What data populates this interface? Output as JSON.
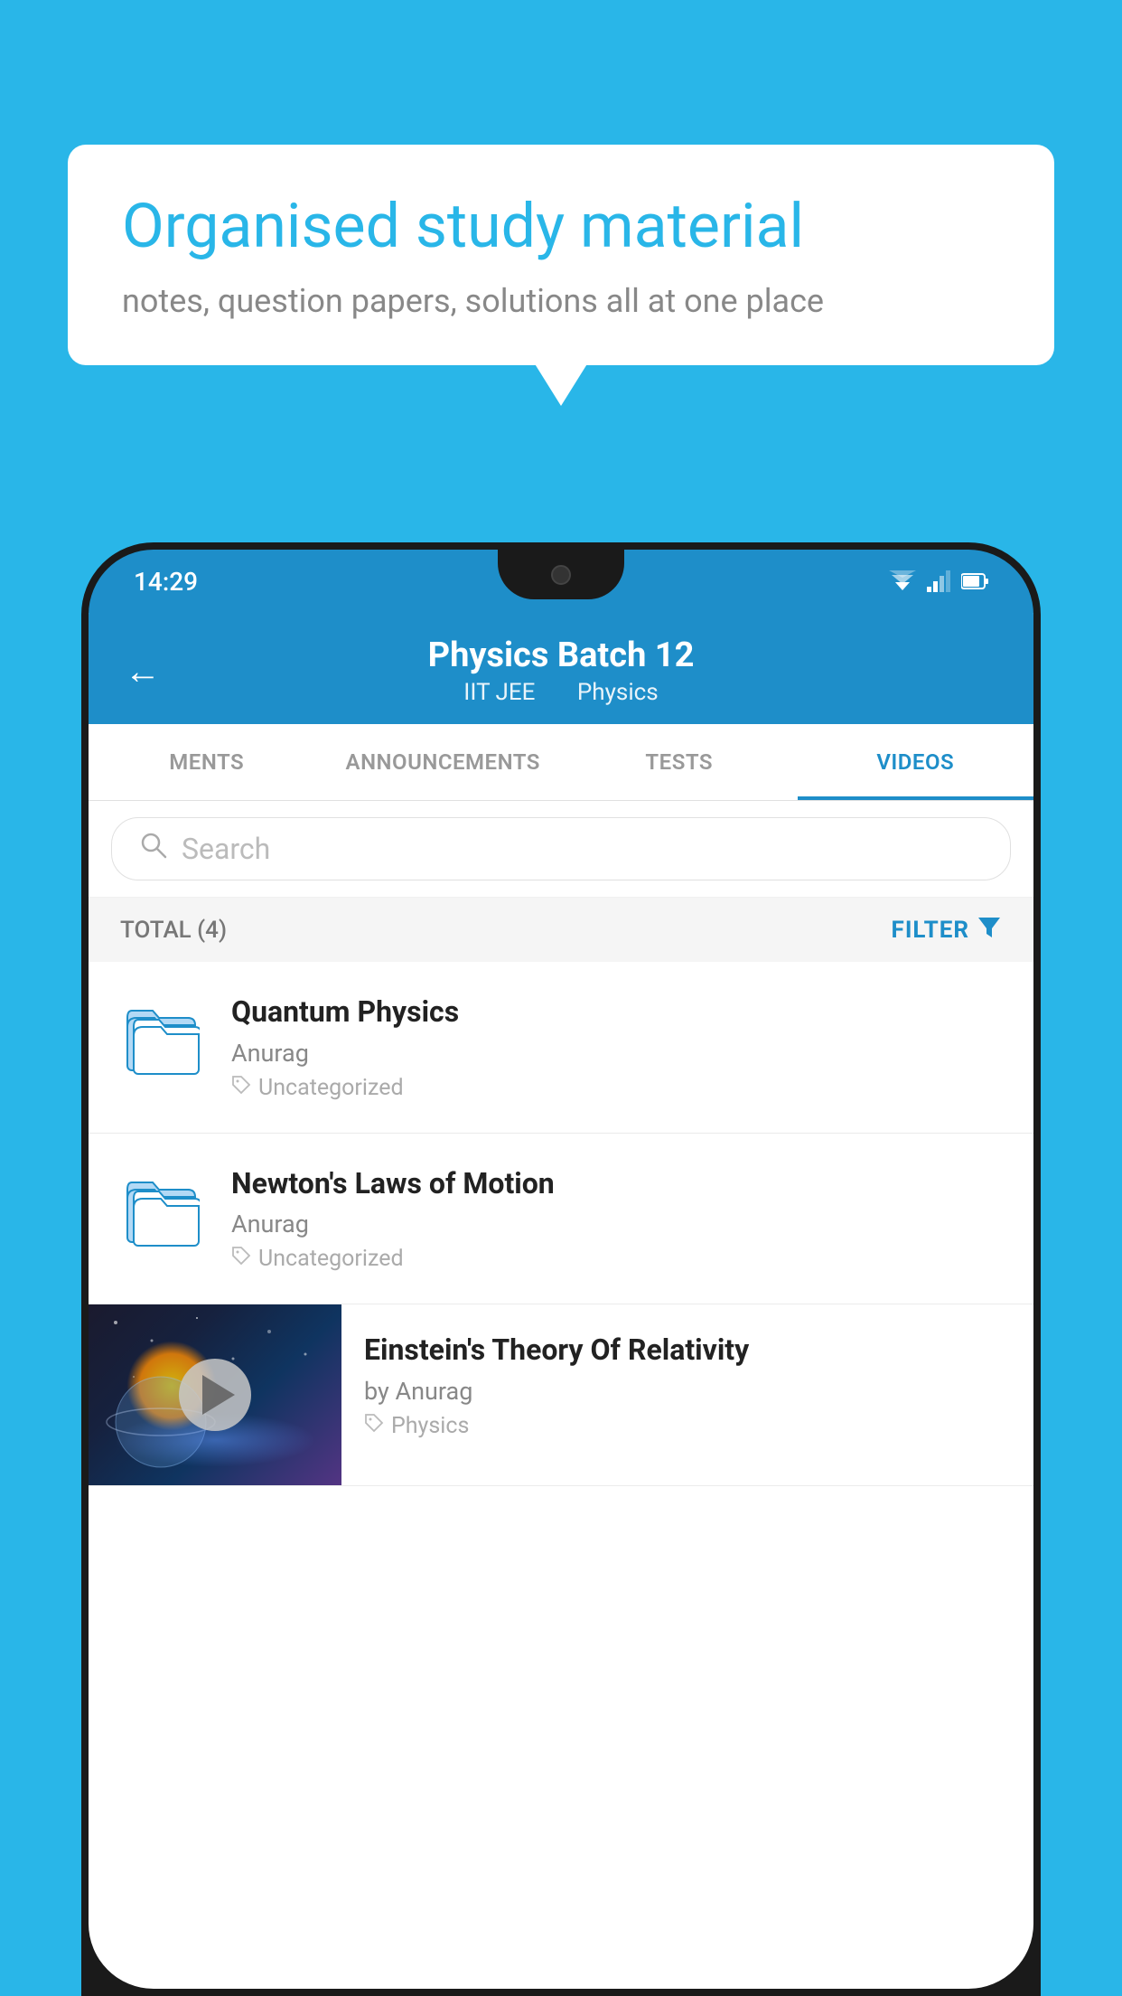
{
  "background_color": "#29b6e8",
  "speech_bubble": {
    "title": "Organised study material",
    "subtitle": "notes, question papers, solutions all at one place"
  },
  "status_bar": {
    "time": "14:29"
  },
  "app_header": {
    "title": "Physics Batch 12",
    "subtitle_part1": "IIT JEE",
    "subtitle_part2": "Physics"
  },
  "tabs": [
    {
      "label": "MENTS",
      "active": false
    },
    {
      "label": "ANNOUNCEMENTS",
      "active": false
    },
    {
      "label": "TESTS",
      "active": false
    },
    {
      "label": "VIDEOS",
      "active": true
    }
  ],
  "search": {
    "placeholder": "Search"
  },
  "filter_bar": {
    "total_label": "TOTAL (4)",
    "filter_label": "FILTER"
  },
  "video_items": [
    {
      "type": "folder",
      "title": "Quantum Physics",
      "author": "Anurag",
      "tag": "Uncategorized"
    },
    {
      "type": "folder",
      "title": "Newton's Laws of Motion",
      "author": "Anurag",
      "tag": "Uncategorized"
    },
    {
      "type": "thumbnail",
      "title": "Einstein's Theory Of Relativity",
      "author": "by Anurag",
      "tag": "Physics"
    }
  ],
  "icons": {
    "back_arrow": "←",
    "search": "🔍",
    "filter": "▼",
    "tag": "🏷",
    "play": "▶"
  }
}
